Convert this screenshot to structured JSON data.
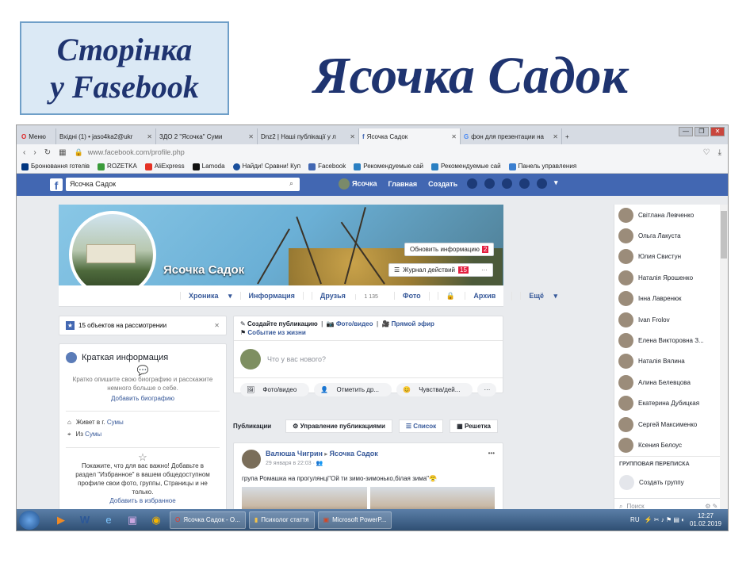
{
  "slide": {
    "box_line1": "Сторінка",
    "box_line2": "у Fasebook",
    "heading": "Ясочка Садок"
  },
  "browser": {
    "tabs": [
      {
        "label": "Меню",
        "active": false
      },
      {
        "label": "Вхідні (1) • jaso4ka2@ukr",
        "active": false
      },
      {
        "label": "ЗДО 2 \"Ясочка\" Суми",
        "active": false
      },
      {
        "label": "Dnz2 | Наші публікації у л",
        "active": false
      },
      {
        "label": "Ясочка Садок",
        "active": true
      },
      {
        "label": "фон для презентации на",
        "active": false
      }
    ],
    "url": "www.facebook.com/profile.php",
    "bookmarks": [
      "Бронювання готелів",
      "ROZETKA",
      "AliExpress",
      "Lamoda",
      "Найди! Сравни! Куп",
      "Facebook",
      "Рекомендуемые сай",
      "Рекомендуемые сай",
      "Панель управления"
    ]
  },
  "fb": {
    "search_value": "Ясочка Садок",
    "nav_profile": "Ясочка",
    "nav_home": "Главная",
    "nav_create": "Создать",
    "profile_name": "Ясочка Садок",
    "btn_update": "Обновить информацию",
    "btn_update_count": "2",
    "btn_log": "Журнал действий",
    "btn_log_count": "15",
    "btn_more": "···",
    "tabs": {
      "timeline": "Хроника",
      "info": "Информация",
      "friends": "Друзья",
      "friends_count": "1 135",
      "photos": "Фото",
      "archive": "Архив",
      "more": "Ещё"
    },
    "review": "15 объектов на рассмотрении",
    "intro": {
      "title": "Краткая информация",
      "desc": "Кратко опишите свою биографию и расскажите немного больше о себе.",
      "add_bio": "Добавить биографию",
      "lives_prefix": "Живет в г.",
      "lives_city": "Сумы",
      "from_prefix": "Из",
      "from_city": "Сумы",
      "featured": "Покажите, что для вас важно! Добавьте в раздел \"Избранное\" в вашем общедоступном профиле свои фото, группы, Страницы и не только.",
      "add_featured": "Добавить в избранное"
    },
    "composer": {
      "create_post": "Создайте публикацию",
      "photo_video": "Фото/видео",
      "live": "Прямой эфир",
      "life_event": "Событие из жизни",
      "placeholder": "Что у вас нового?",
      "btn_photo": "Фото/видео",
      "btn_tag": "Отметить др...",
      "btn_feeling": "Чувства/дей...",
      "btn_more": "···"
    },
    "pubs": {
      "label": "Публикации",
      "manage": "Управление публикациями",
      "list": "Список",
      "grid": "Решетка"
    },
    "post": {
      "author": "Валюша Чигрин",
      "target": "Ясочка Садок",
      "time": "29 января в 22:03 · ",
      "text": "група Ромашка на прогулянці\"Ой ти зимо-зимонько,білая зима\"😤"
    },
    "contacts": [
      "Світлана Левченко",
      "Ольга Лакуста",
      "Юлия Свистун",
      "Наталія Ярошенко",
      "Інна Лавренюк",
      "Ivan Frolov",
      "Елена Викторовна З...",
      "Наталія Вялина",
      "Алина Белевцова",
      "Екатерина Дубицкая",
      "Сергей Максименко",
      "Ксения Белоус"
    ],
    "group_chat": "ГРУППОВАЯ ПЕРЕПИСКА",
    "create_group": "Создать группу",
    "chat_search": "Поиск"
  },
  "taskbar": {
    "items": [
      "Ясочка Садок - О...",
      "Психолог стаття",
      "Microsoft PowerP..."
    ],
    "lang": "RU",
    "time": "12:27",
    "date": "01.02.2019"
  },
  "colors": {
    "fb_blue": "#4267b2",
    "link": "#365899",
    "title_navy": "#1f3470"
  }
}
